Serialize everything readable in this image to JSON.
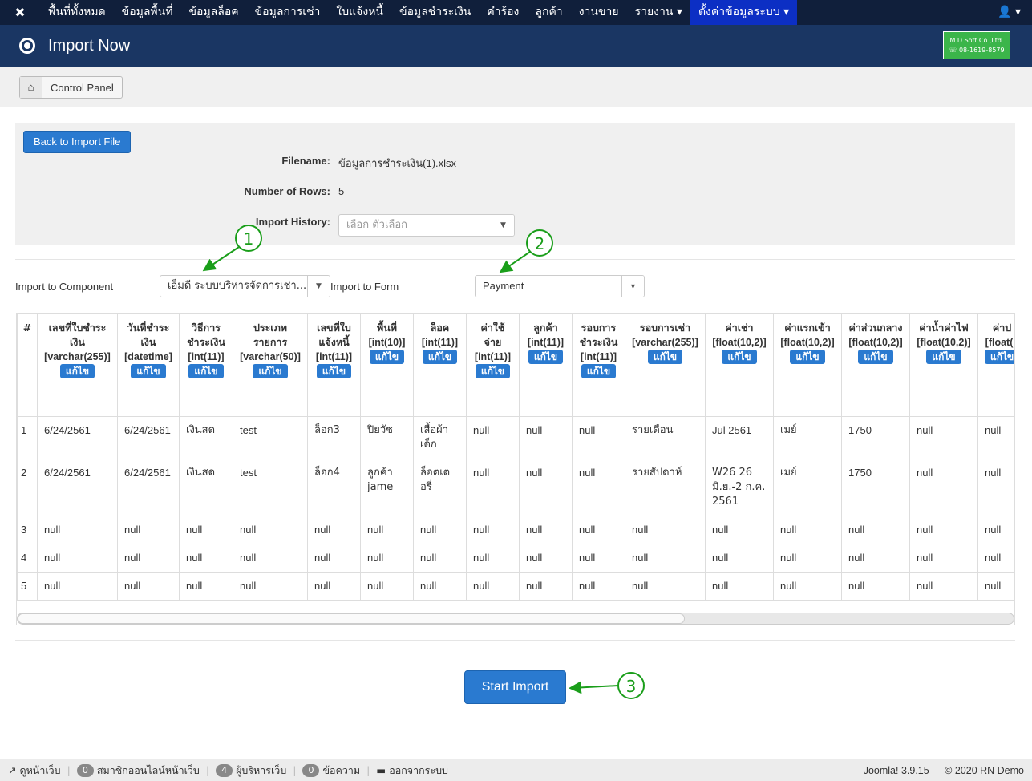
{
  "nav": {
    "items": [
      "พื้นที่ทั้งหมด",
      "ข้อมูลพื้นที่",
      "ข้อมูลล็อค",
      "ข้อมูลการเช่า",
      "ใบแจ้งหนี้",
      "ข้อมูลชำระเงิน",
      "คำร้อง",
      "ลูกค้า",
      "งานขาย",
      "รายงาน ▾",
      "ตั้งค่าข้อมูลระบบ ▾"
    ],
    "user": "👤 ▾"
  },
  "header": {
    "title": "Import Now",
    "brand_line1": "M.D.Soft Co.,Ltd.",
    "brand_line2": "☏ 08-1619-8579"
  },
  "toolbar": {
    "control_panel": "Control Panel"
  },
  "form": {
    "back_label": "Back to Import File",
    "filename_label": "Filename:",
    "filename": "ข้อมูลการชำระเงิน(1).xlsx",
    "rows_label": "Number of Rows:",
    "rows": "5",
    "history_label": "Import History:",
    "history_placeholder": "เลือก ตัวเลือก",
    "component_label": "Import to Component",
    "component_value": "เอ็มดี ระบบบริหารจัดการเช่า...",
    "form_label": "Import to Form",
    "form_value": "Payment"
  },
  "annotations": [
    "1",
    "2",
    "3"
  ],
  "table": {
    "edit_label": "แก้ไข",
    "columns": [
      {
        "name": "#",
        "type": ""
      },
      {
        "name": "เลขที่ใบชำระเงิน",
        "type": "[varchar(255)]"
      },
      {
        "name": "วันที่ชำระเงิน",
        "type": "[datetime]"
      },
      {
        "name": "วิธีการชำระเงิน",
        "type": "[int(11)]"
      },
      {
        "name": "ประเภทรายการ",
        "type": "[varchar(50)]"
      },
      {
        "name": "เลขที่ใบแจ้งหนี้",
        "type": "[int(11)]"
      },
      {
        "name": "พื้นที่",
        "type": "[int(10)]"
      },
      {
        "name": "ล็อค",
        "type": "[int(11)]"
      },
      {
        "name": "ค่าใช้จ่าย",
        "type": "[int(11)]"
      },
      {
        "name": "ลูกค้า",
        "type": "[int(11)]"
      },
      {
        "name": "รอบการชำระเงิน",
        "type": "[int(11)]"
      },
      {
        "name": "รอบการเช่า",
        "type": "[varchar(255)]"
      },
      {
        "name": "ค่าเช่า",
        "type": "[float(10,2)]"
      },
      {
        "name": "ค่าแรกเข้า",
        "type": "[float(10,2)]"
      },
      {
        "name": "ค่าส่วนกลาง",
        "type": "[float(10,2)]"
      },
      {
        "name": "ค่าน้ำค่าไฟ",
        "type": "[float(10,2)]"
      },
      {
        "name": "ค่าป",
        "type": "[float(1"
      }
    ],
    "rows": [
      [
        "1",
        "6/24/2561",
        "6/24/2561",
        "เงินสด",
        "test",
        "ล็อก3",
        "ปิยวัช",
        "เสื้อผ้าเด็ก",
        "null",
        "null",
        "null",
        "รายเดือน",
        "Jul 2561",
        "เมย์",
        "1750",
        "null",
        "null"
      ],
      [
        "2",
        "6/24/2561",
        "6/24/2561",
        "เงินสด",
        "test",
        "ล็อก4",
        "ลูกค้า jame",
        "ล็อตเตอรี่",
        "null",
        "null",
        "null",
        "รายสัปดาห์",
        "W26 26 มิ.ย.-2 ก.ค. 2561",
        "เมย์",
        "1750",
        "null",
        "null"
      ],
      [
        "3",
        "null",
        "null",
        "null",
        "null",
        "null",
        "null",
        "null",
        "null",
        "null",
        "null",
        "null",
        "null",
        "null",
        "null",
        "null",
        "null"
      ],
      [
        "4",
        "null",
        "null",
        "null",
        "null",
        "null",
        "null",
        "null",
        "null",
        "null",
        "null",
        "null",
        "null",
        "null",
        "null",
        "null",
        "null"
      ],
      [
        "5",
        "null",
        "null",
        "null",
        "null",
        "null",
        "null",
        "null",
        "null",
        "null",
        "null",
        "null",
        "null",
        "null",
        "null",
        "null",
        "null"
      ]
    ]
  },
  "actions": {
    "start_import": "Start Import"
  },
  "footer": {
    "view_site": "ดูหน้าเว็บ",
    "visitors_count": "0",
    "visitors": "สมาชิกออนไลน์หน้าเว็บ",
    "admins_count": "4",
    "admins": "ผู้บริหารเว็บ",
    "messages_count": "0",
    "messages": "ข้อความ",
    "logout": "ออกจากระบบ",
    "version": "Joomla! 3.9.15 — © 2020 RN Demo"
  },
  "colors": {
    "nav": "#101f3b",
    "header": "#1a3663",
    "accent": "#2a7ad0",
    "active_nav": "#0c2fc4",
    "annotation": "#1a9e1a"
  }
}
